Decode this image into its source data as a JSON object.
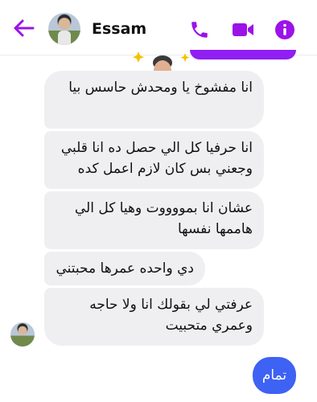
{
  "header": {
    "contact_name": "Essam",
    "accent_color": "#9b13e8",
    "icons": [
      "back-arrow-icon",
      "phone-icon",
      "video-camera-icon",
      "info-icon"
    ]
  },
  "messages": {
    "received": [
      "انا مفشوخ يا ومحدش حاسس بيا",
      "انا حرفيا كل الي حصل ده انا قلبي وجعني بس كان لازم اعمل كده",
      "عشان انا بمووووت وهيا كل الي هاممها نفسها",
      "دي واحده عمرها محبتني",
      "عرفتي لي بقولك انا ولا حاجه وعمري متحبيت"
    ],
    "sent": "تمام"
  },
  "colors": {
    "received_bubble": "#efeff2",
    "sent_bubble": "#3e62f4",
    "sent_top_bubble": "#8f1ff2"
  }
}
